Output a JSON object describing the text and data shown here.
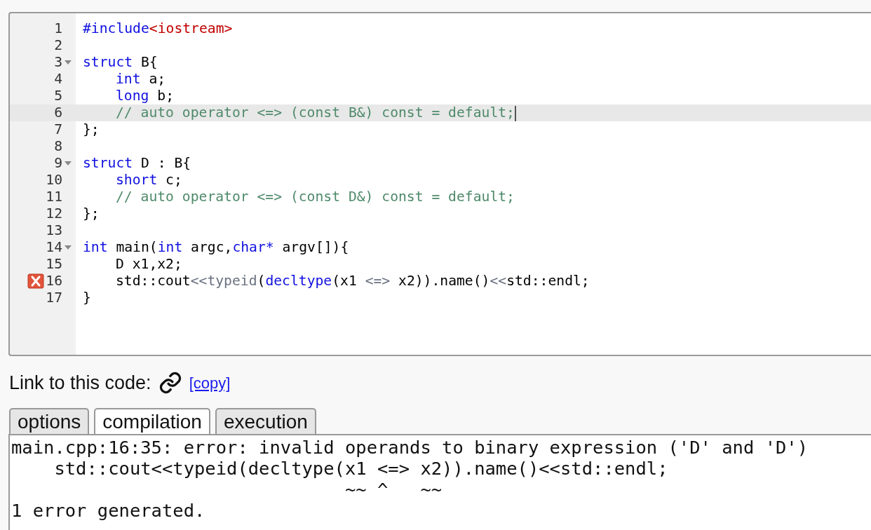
{
  "editor": {
    "lines": [
      {
        "number": "1",
        "fold": false,
        "error": false,
        "active": false,
        "indented": false,
        "tokens": [
          {
            "kind": "keyword",
            "text": "#include"
          },
          {
            "kind": "string",
            "text": "<iostream>"
          }
        ]
      },
      {
        "number": "2",
        "fold": false,
        "error": false,
        "active": false
      },
      {
        "number": "3",
        "fold": true,
        "error": false,
        "active": false,
        "indented": false,
        "tokens": [
          {
            "kind": "keyword",
            "text": "struct"
          },
          {
            "kind": "plain",
            "text": " B{"
          }
        ]
      },
      {
        "number": "4",
        "fold": false,
        "error": false,
        "active": false,
        "indented": true,
        "tokens": [
          {
            "kind": "keyword",
            "text": "int"
          },
          {
            "kind": "plain",
            "text": " a;"
          }
        ]
      },
      {
        "number": "5",
        "fold": false,
        "error": false,
        "active": false,
        "indented": true,
        "tokens": [
          {
            "kind": "keyword",
            "text": "long"
          },
          {
            "kind": "plain",
            "text": " b;"
          }
        ]
      },
      {
        "number": "6",
        "fold": false,
        "error": false,
        "active": true,
        "indented": true,
        "tokens": [
          {
            "kind": "comment",
            "text": "// auto operator <=> (const B&) const = default;"
          }
        ]
      },
      {
        "number": "7",
        "fold": false,
        "error": false,
        "active": false,
        "indented": false,
        "tokens": [
          {
            "kind": "plain",
            "text": "};"
          }
        ]
      },
      {
        "number": "8",
        "fold": false,
        "error": false,
        "active": false
      },
      {
        "number": "9",
        "fold": true,
        "error": false,
        "active": false,
        "indented": false,
        "tokens": [
          {
            "kind": "keyword",
            "text": "struct"
          },
          {
            "kind": "plain",
            "text": " D : B{"
          }
        ]
      },
      {
        "number": "10",
        "fold": false,
        "error": false,
        "active": false,
        "indented": true,
        "tokens": [
          {
            "kind": "keyword",
            "text": "short"
          },
          {
            "kind": "plain",
            "text": " c;"
          }
        ]
      },
      {
        "number": "11",
        "fold": false,
        "error": false,
        "active": false,
        "indented": true,
        "tokens": [
          {
            "kind": "comment",
            "text": "// auto operator <=> (const D&) const = default;"
          }
        ]
      },
      {
        "number": "12",
        "fold": false,
        "error": false,
        "active": false,
        "indented": false,
        "tokens": [
          {
            "kind": "plain",
            "text": "};"
          }
        ]
      },
      {
        "number": "13",
        "fold": false,
        "error": false,
        "active": false
      },
      {
        "number": "14",
        "fold": true,
        "error": false,
        "active": false,
        "indented": false,
        "tokens": [
          {
            "kind": "keyword",
            "text": "int"
          },
          {
            "kind": "plain",
            "text": " main("
          },
          {
            "kind": "keyword",
            "text": "int"
          },
          {
            "kind": "plain",
            "text": " argc,"
          },
          {
            "kind": "keyword",
            "text": "char*"
          },
          {
            "kind": "plain",
            "text": " argv[]){"
          }
        ]
      },
      {
        "number": "15",
        "fold": false,
        "error": false,
        "active": false,
        "indented": true,
        "tokens": [
          {
            "kind": "plain",
            "text": "D x1,x2;"
          }
        ]
      },
      {
        "number": "16",
        "fold": false,
        "error": true,
        "active": false,
        "indented": true,
        "tokens": [
          {
            "kind": "plain",
            "text": "std::cout"
          },
          {
            "kind": "operator",
            "text": "<<typeid"
          },
          {
            "kind": "plain",
            "text": "("
          },
          {
            "kind": "keyword",
            "text": "decltype"
          },
          {
            "kind": "plain",
            "text": "(x1 "
          },
          {
            "kind": "operator",
            "text": "<=>"
          },
          {
            "kind": "plain",
            "text": " x2)).name()"
          },
          {
            "kind": "operator",
            "text": "<<"
          },
          {
            "kind": "plain",
            "text": "std::endl;"
          }
        ]
      },
      {
        "number": "17",
        "fold": false,
        "error": false,
        "active": false,
        "indented": false,
        "tokens": [
          {
            "kind": "plain",
            "text": "}"
          }
        ]
      }
    ]
  },
  "link": {
    "label": "Link to this code:",
    "copy": "[copy]"
  },
  "tabs": [
    {
      "label": "options",
      "selected": false
    },
    {
      "label": "compilation",
      "selected": true
    },
    {
      "label": "execution",
      "selected": false
    }
  ],
  "output": {
    "lines": [
      "main.cpp:16:35: error: invalid operands to binary expression ('D' and 'D')",
      "    std::cout<<typeid(decltype(x1 <=> x2)).name()<<std::endl;",
      "                               ~~ ^   ~~",
      "1 error generated."
    ]
  }
}
